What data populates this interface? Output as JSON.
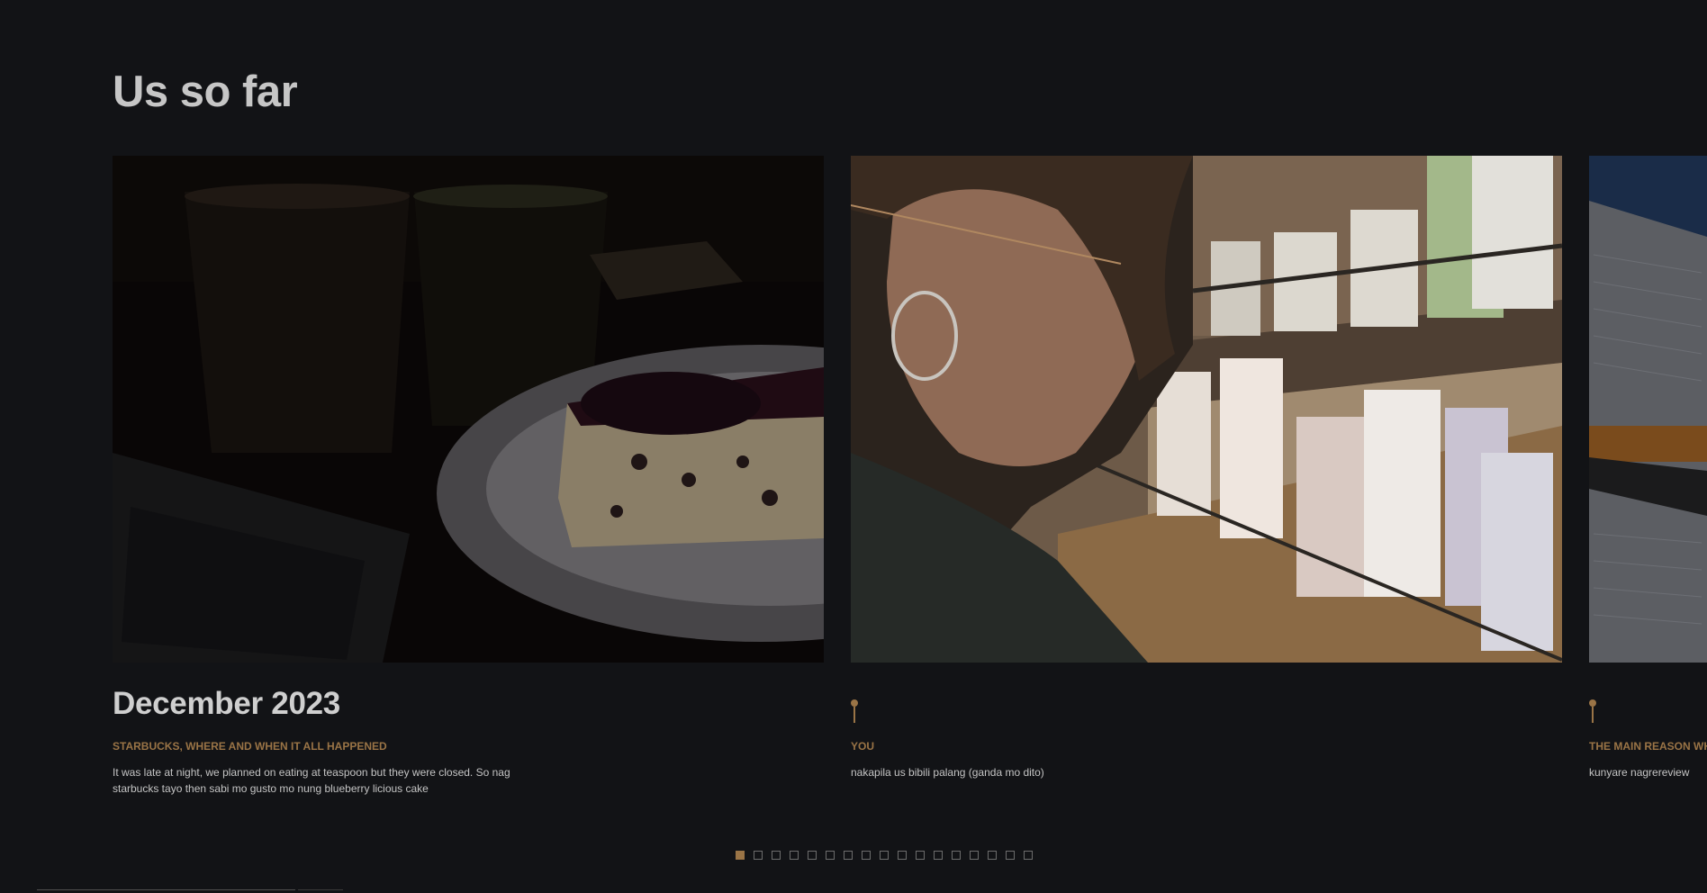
{
  "section": {
    "title": "Us so far"
  },
  "timeline": {
    "cards": [
      {
        "date": "December 2023",
        "subtitle": "STARBUCKS, WHERE AND WHEN IT ALL HAPPENED",
        "text": "It was late at night, we planned on eating at teaspoon but they were closed. So nag starbucks tayo then sabi mo gusto mo nung blueberry licious cake",
        "photo_alt": "Starbucks drinks and blueberry cheesecake on a plate next to a laptop"
      },
      {
        "date": "",
        "subtitle": "YOU",
        "text": "nakapila us bibili palang (ganda mo dito)",
        "photo_alt": "Girl with glasses and hoop earring looking at Starbucks tumblers on shelves"
      },
      {
        "date": "",
        "subtitle": "THE MAIN REASON WHY",
        "text": "kunyare nagrereview",
        "photo_alt": "Papers and pen on a table"
      }
    ]
  },
  "pagination": {
    "total": 17,
    "active": 1
  },
  "colors": {
    "accent": "#9a7446",
    "background": "#121316",
    "title": "#c6c6c6"
  }
}
